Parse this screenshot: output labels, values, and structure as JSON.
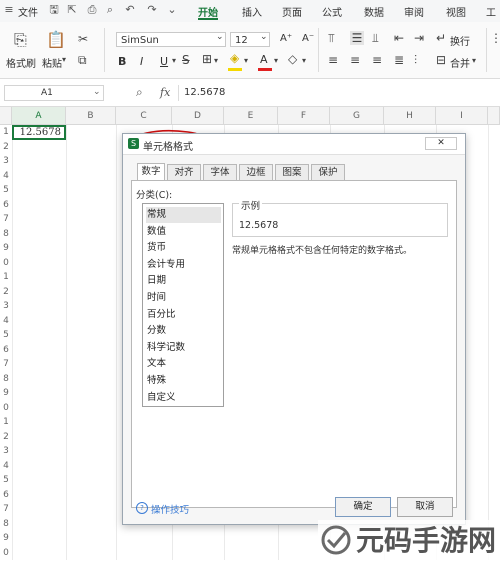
{
  "menubar": {
    "file_label": "文件",
    "tabs": [
      {
        "label": "开始",
        "active": true
      },
      {
        "label": "插入"
      },
      {
        "label": "页面"
      },
      {
        "label": "公式"
      },
      {
        "label": "数据"
      },
      {
        "label": "审阅"
      },
      {
        "label": "视图"
      },
      {
        "label": "工"
      }
    ],
    "accent_color": "#1a7a3c"
  },
  "ribbon": {
    "format_painter_label": "格式刷",
    "paste_label": "粘贴",
    "font_name": "SimSun",
    "font_size": "12",
    "bold_label": "B",
    "italic_label": "I",
    "underline_label": "U",
    "font_grow_label": "A⁺",
    "font_shrink_label": "A⁻",
    "wrap_text_label": "换行",
    "merge_label": "合并"
  },
  "formula_bar": {
    "name_box": "A1",
    "fx_label": "fx",
    "value": "12.5678"
  },
  "grid": {
    "columns": [
      "A",
      "B",
      "C",
      "D",
      "E",
      "F",
      "G",
      "H",
      "I"
    ],
    "rows": [
      "1",
      "2",
      "3",
      "4",
      "5",
      "6",
      "7",
      "8",
      "9",
      "0",
      "1",
      "2",
      "3",
      "4",
      "5",
      "6",
      "7",
      "8",
      "9",
      "0",
      "1",
      "2",
      "3",
      "4",
      "5",
      "6",
      "7",
      "8",
      "9",
      "0",
      "1"
    ],
    "cell_a1": "12.5678"
  },
  "dialog": {
    "title": "单元格格式",
    "close_label": "✕",
    "tabs": [
      "数字",
      "对齐",
      "字体",
      "边框",
      "图案",
      "保护"
    ],
    "active_tab": "数字",
    "category_label": "分类(C):",
    "categories": [
      "常规",
      "数值",
      "货币",
      "会计专用",
      "日期",
      "时间",
      "百分比",
      "分数",
      "科学记数",
      "文本",
      "特殊",
      "自定义"
    ],
    "selected_category": "常规",
    "sample_label": "示例",
    "sample_value": "12.5678",
    "description": "常规单元格格式不包含任何特定的数字格式。",
    "tips_label": "操作技巧",
    "ok_label": "确定",
    "cancel_label": "取消"
  },
  "watermark": {
    "text": "元码手游网"
  }
}
